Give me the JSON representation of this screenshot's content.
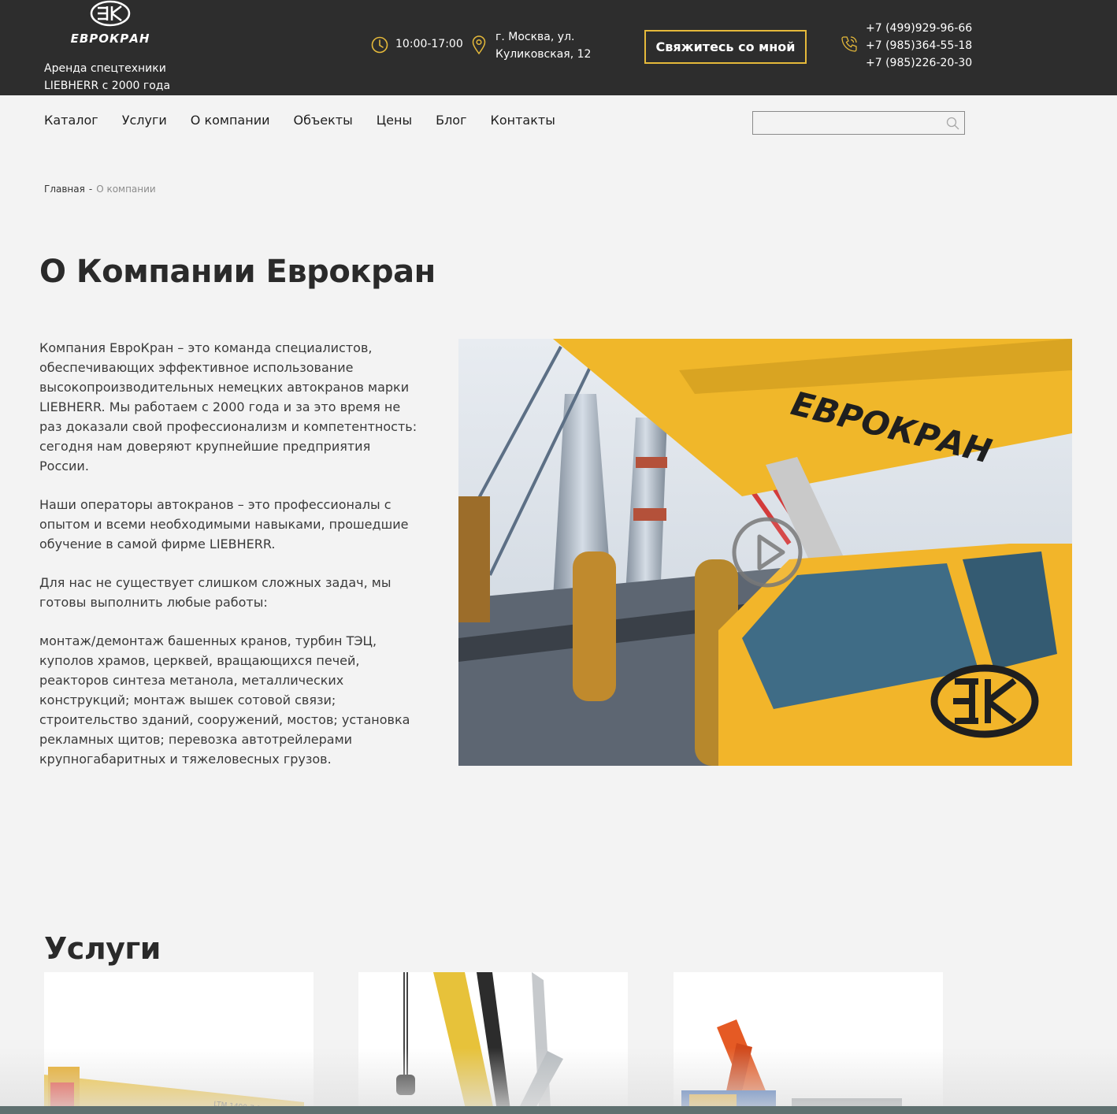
{
  "header": {
    "logo_text": "ЕВРОКРАН",
    "tagline_line1": "Аренда спецтехники",
    "tagline_line2": "LIEBHERR с 2000 года",
    "hours": "10:00-17:00",
    "address_line1": "г. Москва, ул.",
    "address_line2": "Куликовская, 12",
    "cta_label": "Свяжитесь со мной",
    "phones": [
      "+7 (499)929-96-66",
      "+7 (985)364-55-18",
      "+7 (985)226-20-30"
    ],
    "accent_color": "#e5b93a",
    "background_color": "#2d2d2d",
    "icons": [
      "clock-icon",
      "map-pin-icon",
      "phone-icon"
    ]
  },
  "nav": {
    "items": [
      "Каталог",
      "Услуги",
      "О компании",
      "Объекты",
      "Цены",
      "Блог",
      "Контакты"
    ],
    "search_value": "",
    "search_icon": "search-icon"
  },
  "breadcrumb": {
    "home": "Главная",
    "separator": "-",
    "current": "О компании"
  },
  "main": {
    "title": "О Компании Еврокран",
    "paragraphs": [
      "Компания ЕвроКран – это команда специалистов, обеспечивающих эффективное использование высокопроизводительных немецких автокранов марки LIEBHERR. Мы работаем с 2000 года и за это время не раз доказали свой профессионализм и компетентность: сегодня нам доверяют крупнейшие предприятия России.",
      "Наши операторы автокранов – это профессионалы с опытом и всеми необходимыми навыками, прошедшие обучение в самой фирме LIEBHERR.",
      "Для нас не существует слишком сложных задач, мы готовы выполнить любые работы:",
      "монтаж/демонтаж башенных кранов, турбин ТЭЦ, куполов храмов, церквей, вращающихся печей, реакторов синтеза метанола, металлических конструкций; монтаж вышек сотовой связи; строительство зданий, сооружений, мостов; установка рекламных щитов; перевозка автотрейлерами крупногабаритных и тяжеловесных грузов."
    ],
    "video": {
      "boom_text": "ЕВРОКРАН",
      "play_icon": "play-icon"
    }
  },
  "services": {
    "title": "Услуги",
    "cards": [
      {
        "crane_label": "LTM 1400-7.1"
      },
      {},
      {}
    ]
  }
}
